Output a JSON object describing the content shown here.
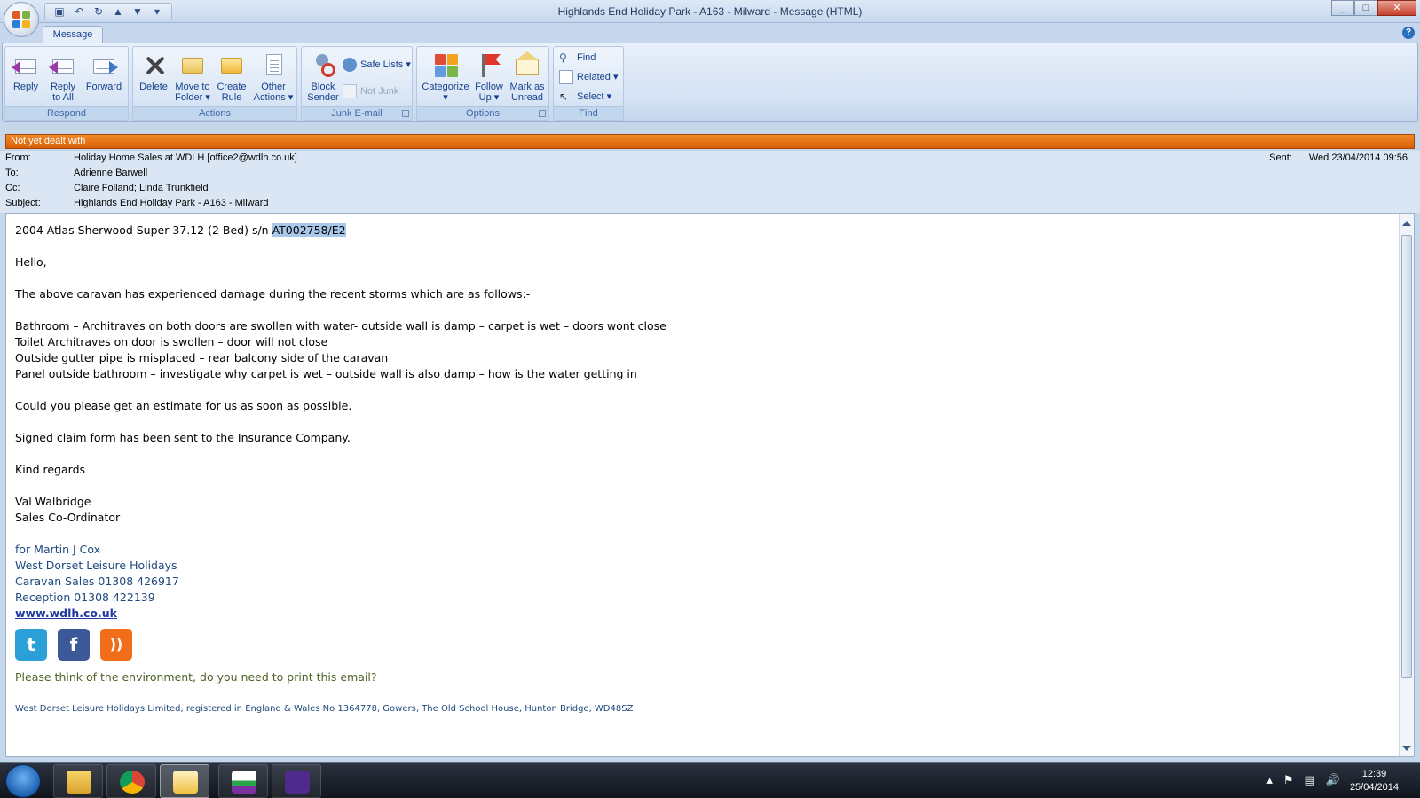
{
  "window": {
    "title": "Highlands End Holiday Park - A163 - Milward - Message (HTML)",
    "controls": [
      "_",
      "□",
      "✕"
    ]
  },
  "qat": [
    "save-icon",
    "undo-icon",
    "redo-icon",
    "previous-icon",
    "next-icon",
    "customize-icon"
  ],
  "ribbon": {
    "tabs": [
      {
        "label": "Message"
      }
    ],
    "groups": {
      "respond": {
        "label": "Respond",
        "reply": "Reply",
        "reply_all_1": "Reply",
        "reply_all_2": "to All",
        "forward": "Forward"
      },
      "actions": {
        "label": "Actions",
        "delete": "Delete",
        "move_1": "Move to",
        "move_2": "Folder ▾",
        "rule_1": "Create",
        "rule_2": "Rule",
        "other_1": "Other",
        "other_2": "Actions ▾"
      },
      "junk": {
        "label": "Junk E-mail",
        "block_1": "Block",
        "block_2": "Sender",
        "safe_lists": "Safe Lists ▾",
        "not_junk": "Not Junk"
      },
      "options": {
        "label": "Options",
        "categorize": "Categorize",
        "categorize_arrow": "▾",
        "follow_1": "Follow",
        "follow_2": "Up ▾",
        "mark_1": "Mark as",
        "mark_2": "Unread"
      },
      "find": {
        "label": "Find",
        "find": "Find",
        "related": "Related ▾",
        "select": "Select ▾"
      }
    }
  },
  "flag_status": "Not yet dealt with",
  "headers": {
    "from_label": "From:",
    "from": "Holiday Home Sales at WDLH [office2@wdlh.co.uk]",
    "to_label": "To:",
    "to": "Adrienne Barwell",
    "cc_label": "Cc:",
    "cc": "Claire Folland; Linda Trunkfield",
    "subject_label": "Subject:",
    "subject": "Highlands End Holiday Park - A163 - Milward",
    "sent_label": "Sent:",
    "sent": "Wed 23/04/2014 09:56"
  },
  "body": {
    "first_line_prefix": "2004 Atlas Sherwood Super 37.12 (2 Bed) s/n ",
    "first_line_selected": "AT002758/E2",
    "greeting": "Hello,",
    "intro": "The above caravan has experienced damage during the recent storms which are as follows:-",
    "damage": [
      "Bathroom – Architraves on both doors are swollen with water- outside wall is damp – carpet is wet – doors wont close",
      "Toilet Architraves on door is swollen – door will not close",
      "Outside gutter pipe is misplaced – rear balcony side of the caravan",
      "Panel outside bathroom – investigate why carpet is wet – outside wall is also damp – how is the water getting in"
    ],
    "request": "Could you please get an estimate for us as soon as possible.",
    "claim": "Signed claim form has been sent to the Insurance Company.",
    "signoff": "Kind regards",
    "sender_name": "Val Walbridge",
    "sender_title": "Sales Co-Ordinator",
    "signature": [
      "for Martin J Cox",
      "West Dorset Leisure Holidays",
      "Caravan Sales 01308 426917",
      "Reception 01308 422139"
    ],
    "website": "www.wdlh.co.uk",
    "social": [
      {
        "name": "twitter",
        "glyph": "t",
        "color": "#2a9fd8"
      },
      {
        "name": "facebook",
        "glyph": "f",
        "color": "#3b5998"
      },
      {
        "name": "rss",
        "glyph": "))",
        "color": "#f26d1a"
      }
    ],
    "environment_note": "Please think of the environment, do you need to print this email?",
    "footer": "West Dorset Leisure Holidays Limited, registered in England & Wales No 1364778, Gowers, The Old School House, Hunton Bridge, WD48SZ"
  },
  "taskbar": {
    "apps": [
      "windows-explorer",
      "chrome",
      "outlook",
      "sage",
      "calendar-app"
    ],
    "time": "12:39",
    "date": "25/04/2014"
  }
}
